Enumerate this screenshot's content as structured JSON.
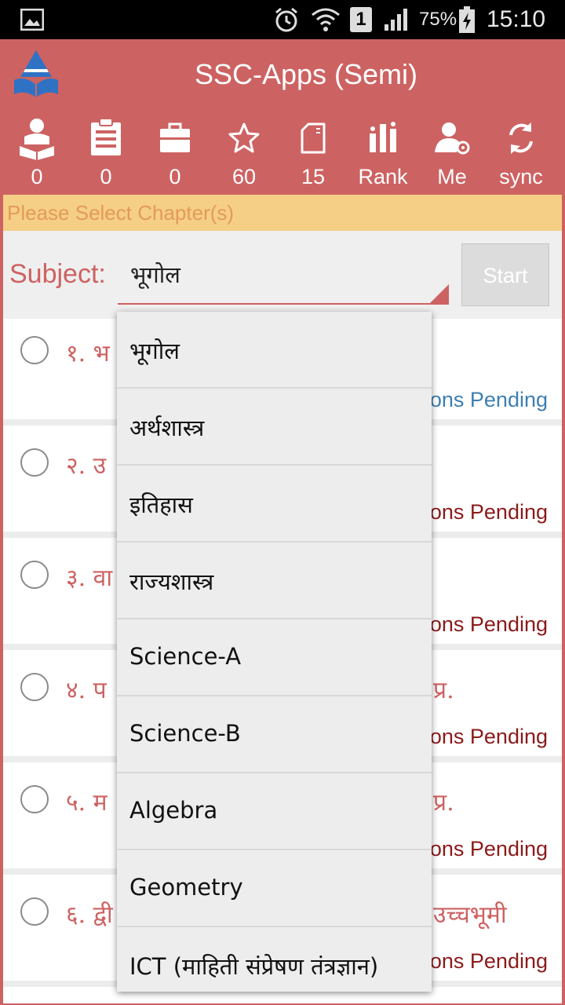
{
  "status_bar": {
    "battery": "75%",
    "time": "15:10",
    "sim_badge": "1"
  },
  "header": {
    "title": "SSC-Apps (Semi)",
    "toolbar": [
      {
        "icon": "reader-icon",
        "label": "0"
      },
      {
        "icon": "clipboard-icon",
        "label": "0"
      },
      {
        "icon": "briefcase-icon",
        "label": "0"
      },
      {
        "icon": "star-icon",
        "label": "60"
      },
      {
        "icon": "card-icon",
        "label": "15"
      },
      {
        "icon": "rank-icon",
        "label": "Rank"
      },
      {
        "icon": "user-settings-icon",
        "label": "Me"
      },
      {
        "icon": "sync-icon",
        "label": "sync"
      }
    ]
  },
  "banner": "Please Select Chapter(s)",
  "subject": {
    "label": "Subject:",
    "value": "भूगोल",
    "start_label": "Start"
  },
  "chapters": [
    {
      "title": "१. भ",
      "right": "",
      "status": "ons Pending"
    },
    {
      "title": "२. उ",
      "right": "",
      "status": "ons Pending"
    },
    {
      "title": "३. वा",
      "right": "",
      "status": "ons Pending"
    },
    {
      "title": "४. प",
      "right": "प्र.",
      "status": "ons Pending"
    },
    {
      "title": "५. म",
      "right": "प्र.",
      "status": "ons Pending"
    },
    {
      "title": "६. द्वी",
      "right": "उच्चभूमी",
      "status": "ons Pending"
    }
  ],
  "dropdown_options": [
    "भूगोल",
    "अर्थशास्त्र",
    "इतिहास",
    "राज्यशास्त्र",
    "Science-A",
    "Science-B",
    "Algebra",
    "Geometry",
    "ICT (माहिती संप्रेषण तंत्रज्ञान)"
  ],
  "colors": {
    "primary": "#cd6262",
    "banner_bg": "#f5cf86",
    "banner_text": "#e49a5a",
    "status_blue": "#3d7fb0",
    "status_red": "#8b1a1a"
  }
}
